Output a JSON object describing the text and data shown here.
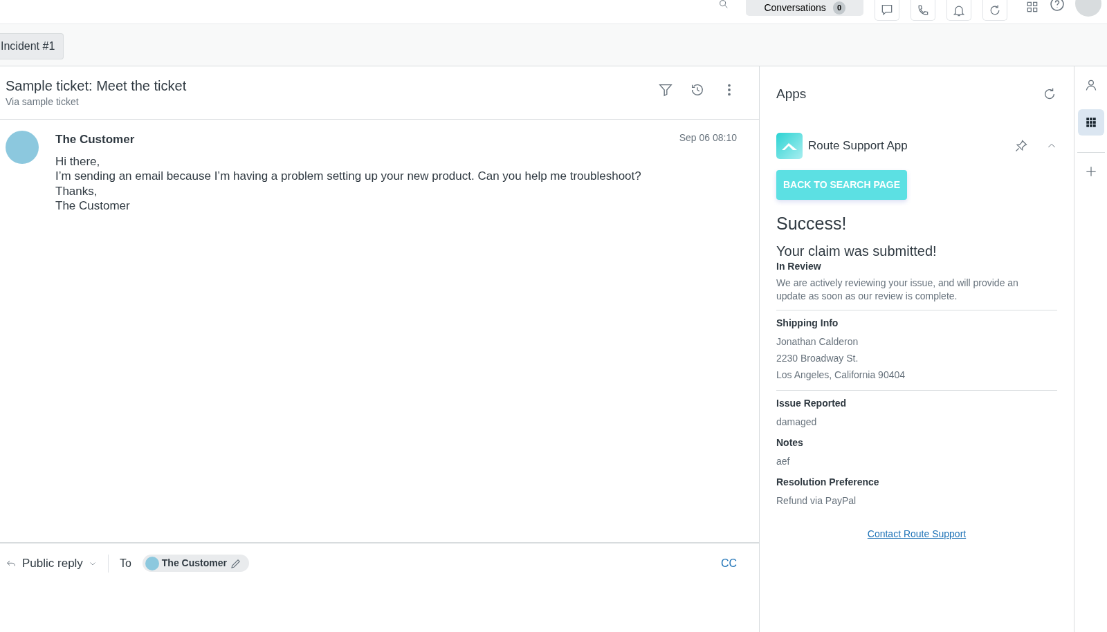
{
  "top_bar": {
    "conversations": {
      "label": "Conversations",
      "count": "0"
    }
  },
  "tab": {
    "label": "Incident #1"
  },
  "ticket": {
    "title": "Sample ticket: Meet the ticket",
    "subtitle": "Via sample ticket"
  },
  "message": {
    "author": "The Customer",
    "time": "Sep 06 08:10",
    "lines": [
      "Hi there,",
      "I’m sending an email because I’m having a problem setting up your new product. Can you help me troubleshoot?",
      "Thanks,",
      "The Customer"
    ]
  },
  "reply": {
    "mode": "Public reply",
    "to_label": "To",
    "recipient": "The Customer",
    "cc": "CC"
  },
  "apps_panel": {
    "title": "Apps",
    "app": {
      "name": "Route Support App",
      "expanded": true,
      "button": "BACK TO SEARCH PAGE",
      "heading": "Success!",
      "subheading": "Your claim was submitted!",
      "sections": [
        {
          "label": "In Review",
          "lines": [
            "We are actively reviewing your issue, and will provide an update as soon as our review is complete."
          ],
          "divider_after": true
        },
        {
          "label": "Shipping Info",
          "lines": [
            "Jonathan Calderon",
            "2230 Broadway St.",
            "Los Angeles, California 90404"
          ],
          "divider_after": true
        },
        {
          "label": "Issue Reported",
          "lines": [
            "damaged"
          ],
          "divider_after": false
        },
        {
          "label": "Notes",
          "lines": [
            "aef"
          ],
          "divider_after": false
        },
        {
          "label": "Resolution Preference",
          "lines": [
            "Refund via PayPal"
          ],
          "divider_after": false
        }
      ],
      "link": "Contact Route Support"
    }
  },
  "rail": [
    {
      "kind": "user",
      "selected": false
    },
    {
      "kind": "apps",
      "selected": true
    },
    {
      "kind": "add",
      "selected": false
    }
  ]
}
